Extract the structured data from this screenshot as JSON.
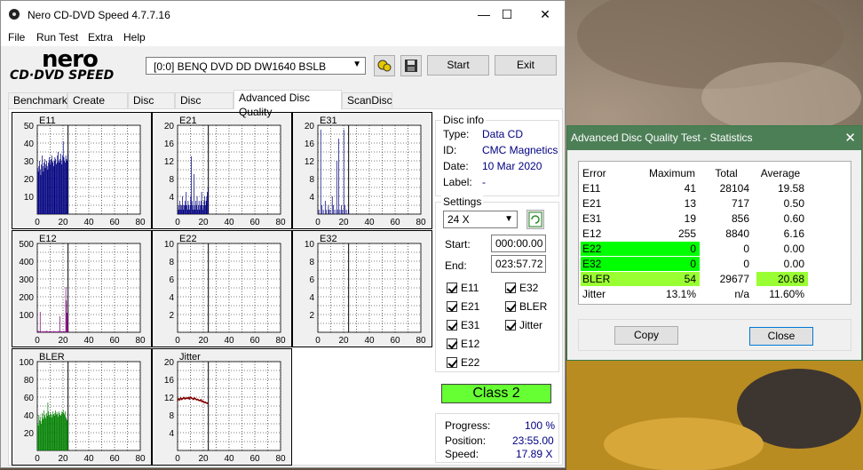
{
  "app": {
    "title": "Nero CD-DVD Speed 4.7.7.16",
    "min_glyph": "—",
    "max_glyph": "☐",
    "close_glyph": "✕"
  },
  "menu": [
    "File",
    "Run Test",
    "Extra",
    "Help"
  ],
  "logo": {
    "line1": "nero",
    "line2": "CD·DVD SPEED"
  },
  "drive": {
    "label": "[0:0]   BENQ DVD DD DW1640 BSLB"
  },
  "toolbar": {
    "start_label": "Start",
    "exit_label": "Exit"
  },
  "tabs": [
    "Benchmark",
    "Create Disc",
    "Disc Info",
    "Disc Quality",
    "Advanced Disc Quality",
    "ScanDisc"
  ],
  "active_tab": "Advanced Disc Quality",
  "disc_info": {
    "group_title": "Disc info",
    "type_label": "Type:",
    "type_value": "Data CD",
    "id_label": "ID:",
    "id_value": "CMC Magnetics",
    "date_label": "Date:",
    "date_value": "10 Mar 2020",
    "label_label": "Label:",
    "label_value": "-"
  },
  "settings": {
    "group_title": "Settings",
    "speed": "24 X",
    "start_label": "Start:",
    "start_value": "000:00.00",
    "end_label": "End:",
    "end_value": "023:57.72",
    "checkboxes": [
      "E11",
      "E32",
      "E21",
      "BLER",
      "E31",
      "Jitter",
      "E12",
      "E22"
    ]
  },
  "class_label": "Class 2",
  "progress": {
    "progress_label": "Progress:",
    "progress_value": "100 %",
    "position_label": "Position:",
    "position_value": "23:55.00",
    "speed_label": "Speed:",
    "speed_value": "17.89 X"
  },
  "colors": {
    "navy": "#00007f",
    "purple": "#7f007f",
    "green": "#008000",
    "maroon": "#800000",
    "class_green": "#66ff33",
    "dialog_title": "#4d7f57",
    "highlight_green": "#00ff00",
    "highlight_lime": "#99ff33"
  },
  "chart_data": [
    {
      "name": "E11",
      "type": "bar",
      "ylim": [
        0,
        50
      ],
      "yticks": [
        "50",
        "40",
        "30",
        "20",
        "10"
      ],
      "xticks": [
        "0",
        "20",
        "40",
        "60",
        "80"
      ],
      "xlim": [
        0,
        80
      ],
      "data_end_x": 23.9,
      "color": "#00007f",
      "values": [
        26,
        24,
        27,
        30,
        25,
        22,
        28,
        33,
        27,
        24,
        29,
        31,
        26,
        28,
        30,
        27,
        25,
        29,
        32,
        30,
        28,
        31,
        33,
        30,
        29,
        27,
        30,
        32,
        31,
        28,
        29,
        33,
        35,
        30,
        29,
        31,
        34,
        30,
        28,
        33,
        41,
        32,
        30,
        29,
        33,
        31,
        30,
        34
      ]
    },
    {
      "name": "E21",
      "type": "bar",
      "ylim": [
        0,
        20
      ],
      "yticks": [
        "20",
        "16",
        "12",
        "8",
        "4"
      ],
      "xticks": [
        "0",
        "20",
        "40",
        "60",
        "80"
      ],
      "xlim": [
        0,
        80
      ],
      "data_end_x": 23.9,
      "color": "#00007f",
      "values": [
        1,
        2,
        1,
        3,
        2,
        1,
        2,
        4,
        2,
        1,
        2,
        3,
        2,
        5,
        2,
        1,
        3,
        2,
        1,
        2,
        4,
        13,
        3,
        2,
        1,
        9,
        2,
        1,
        3,
        2,
        4,
        1,
        2,
        3,
        1,
        2,
        3,
        5,
        2,
        1,
        2,
        3,
        4,
        2,
        3,
        4,
        5,
        6
      ]
    },
    {
      "name": "E31",
      "type": "bar",
      "ylim": [
        0,
        20
      ],
      "yticks": [
        "20",
        "16",
        "12",
        "8",
        "4"
      ],
      "xticks": [
        "0",
        "20",
        "40",
        "60",
        "80"
      ],
      "xlim": [
        0,
        80
      ],
      "data_end_x": 23.9,
      "color": "#00007f",
      "values": [
        0,
        1,
        0,
        0,
        19,
        0,
        2,
        0,
        1,
        0,
        0,
        3,
        0,
        1,
        0,
        0,
        2,
        1,
        0,
        1,
        0,
        0,
        4,
        0,
        2,
        0,
        1,
        0,
        0,
        12,
        1,
        0,
        17,
        0,
        1,
        0,
        2,
        0,
        1,
        0,
        19,
        0,
        2,
        0,
        1,
        0,
        0,
        1
      ]
    },
    {
      "name": "E12",
      "type": "bar",
      "ylim": [
        0,
        500
      ],
      "yticks": [
        "500",
        "400",
        "300",
        "200",
        "100"
      ],
      "xticks": [
        "0",
        "20",
        "40",
        "60",
        "80"
      ],
      "xlim": [
        0,
        80
      ],
      "data_end_x": 23.9,
      "color": "#7f007f",
      "values": [
        10,
        5,
        8,
        4,
        115,
        6,
        3,
        5,
        2,
        8,
        4,
        6,
        3,
        5,
        9,
        4,
        7,
        3,
        6,
        4,
        8,
        5,
        3,
        6,
        4,
        7,
        5,
        3,
        6,
        4,
        5,
        3,
        8,
        4,
        6,
        90,
        5,
        4,
        7,
        3,
        6,
        8,
        5,
        4,
        255,
        180,
        110,
        95
      ]
    },
    {
      "name": "E22",
      "type": "bar",
      "ylim": [
        0,
        10
      ],
      "yticks": [
        "10",
        "8",
        "6",
        "4",
        "2"
      ],
      "xticks": [
        "0",
        "20",
        "40",
        "60",
        "80"
      ],
      "xlim": [
        0,
        80
      ],
      "data_end_x": 23.9,
      "color": "#00007f",
      "values": []
    },
    {
      "name": "E32",
      "type": "bar",
      "ylim": [
        0,
        10
      ],
      "yticks": [
        "10",
        "8",
        "6",
        "4",
        "2"
      ],
      "xticks": [
        "0",
        "20",
        "40",
        "60",
        "80"
      ],
      "xlim": [
        0,
        80
      ],
      "data_end_x": 23.9,
      "color": "#00007f",
      "values": []
    },
    {
      "name": "BLER",
      "type": "bar",
      "ylim": [
        0,
        100
      ],
      "yticks": [
        "100",
        "80",
        "60",
        "40",
        "20"
      ],
      "xticks": [
        "0",
        "20",
        "40",
        "60",
        "80"
      ],
      "xlim": [
        0,
        80
      ],
      "data_end_x": 23.9,
      "color": "#008000",
      "values": [
        30,
        28,
        40,
        34,
        38,
        33,
        30,
        42,
        37,
        35,
        45,
        40,
        38,
        36,
        42,
        39,
        54,
        44,
        40,
        38,
        43,
        41,
        37,
        40,
        44,
        41,
        39,
        42,
        45,
        40,
        43,
        41,
        38,
        44,
        42,
        40,
        39,
        41,
        44,
        43,
        46,
        42,
        40,
        44,
        38,
        36,
        34,
        32
      ]
    },
    {
      "name": "Jitter",
      "type": "line",
      "ylim": [
        0,
        20
      ],
      "yticks": [
        "20",
        "16",
        "12",
        "8",
        "4"
      ],
      "xticks": [
        "0",
        "20",
        "40",
        "60",
        "80"
      ],
      "xlim": [
        0,
        80
      ],
      "data_end_x": 23.9,
      "color": "#800000",
      "values": [
        11.2,
        11.6,
        11.4,
        11.8,
        11.5,
        11.7,
        11.9,
        11.6,
        11.8,
        11.7,
        11.9,
        11.6,
        12.0,
        11.8,
        11.7,
        11.5,
        11.8,
        11.6,
        11.4,
        11.5,
        11.3,
        11.2,
        11.4,
        11.0,
        11.1,
        10.8,
        10.9,
        10.7,
        10.6,
        10.8
      ]
    }
  ],
  "stats": {
    "title": "Advanced Disc Quality Test - Statistics",
    "close_glyph": "✕",
    "headers": [
      "Error",
      "Maximum",
      "Total",
      "Average"
    ],
    "rows": [
      [
        "E11",
        "41",
        "28104",
        "19.58"
      ],
      [
        "E21",
        "13",
        "717",
        "0.50"
      ],
      [
        "E31",
        "19",
        "856",
        "0.60"
      ],
      [
        "E12",
        "255",
        "8840",
        "6.16"
      ],
      [
        "E22",
        "0",
        "0",
        "0.00"
      ],
      [
        "E32",
        "0",
        "0",
        "0.00"
      ],
      [
        "BLER",
        "54",
        "29677",
        "20.68"
      ],
      [
        "Jitter",
        "13.1%",
        "n/a",
        "11.60%"
      ]
    ],
    "copy_label": "Copy",
    "close_label": "Close"
  }
}
